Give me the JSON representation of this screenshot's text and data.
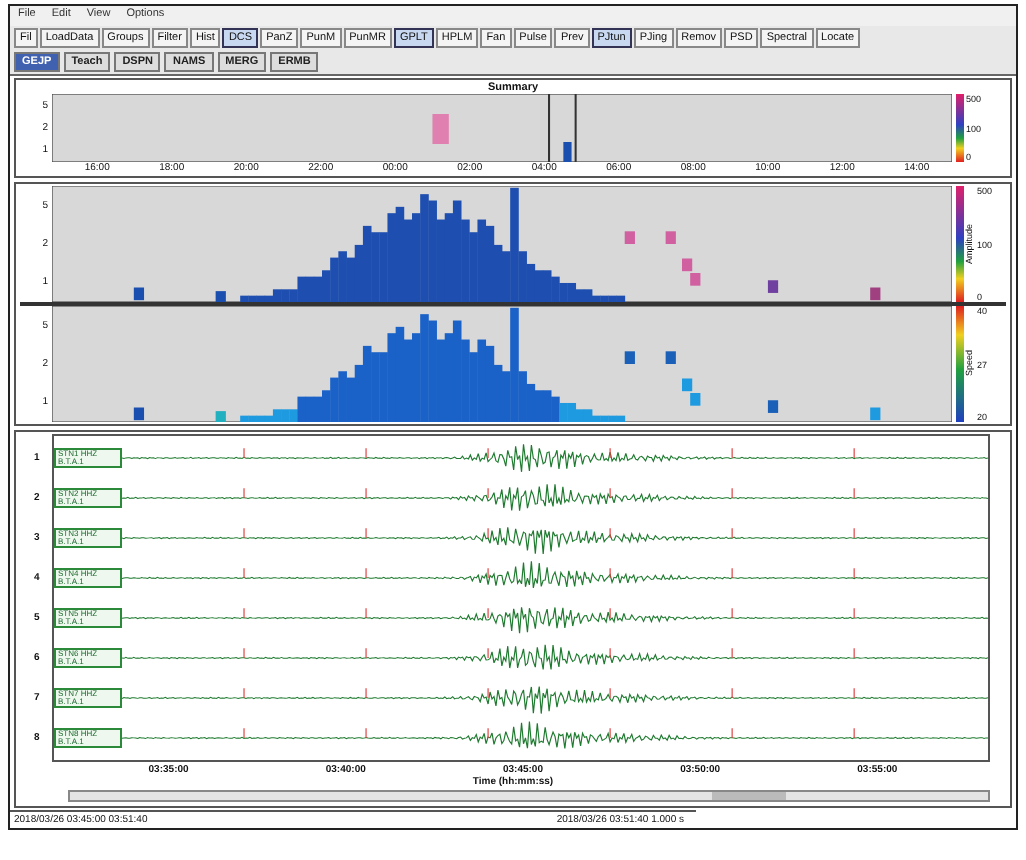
{
  "menu": [
    "File",
    "Edit",
    "View",
    "Options"
  ],
  "toolbar": [
    {
      "label": "Fil",
      "selected": false
    },
    {
      "label": "LoadData",
      "selected": false
    },
    {
      "label": "Groups",
      "selected": false
    },
    {
      "label": "Filter",
      "selected": false
    },
    {
      "label": "Hist",
      "selected": false
    },
    {
      "label": "DCS",
      "selected": true
    },
    {
      "label": "PanZ",
      "selected": false
    },
    {
      "label": "PunM",
      "selected": false
    },
    {
      "label": "PunMR",
      "selected": false
    },
    {
      "label": "GPLT",
      "selected": true
    },
    {
      "label": "HPLM",
      "selected": false
    },
    {
      "label": "Fan",
      "selected": false
    },
    {
      "label": "Pulse",
      "selected": false
    },
    {
      "label": "Prev",
      "selected": false
    },
    {
      "label": "PJtun",
      "selected": true
    },
    {
      "label": "PJing",
      "selected": false
    },
    {
      "label": "Remov",
      "selected": false
    },
    {
      "label": "PSD",
      "selected": false
    },
    {
      "label": "Spectral",
      "selected": false
    },
    {
      "label": "Locate",
      "selected": false
    }
  ],
  "tabs": [
    {
      "label": "GEJP",
      "selected": true
    },
    {
      "label": "Teach",
      "selected": false
    },
    {
      "label": "DSPN",
      "selected": false
    },
    {
      "label": "NAMS",
      "selected": false
    },
    {
      "label": "MERG",
      "selected": false
    },
    {
      "label": "ERMB",
      "selected": false
    }
  ],
  "summary": {
    "title": "Summary",
    "yticks": [
      "5",
      "2",
      "1"
    ],
    "xticks": [
      "16:00",
      "18:00",
      "20:00",
      "22:00",
      "00:00",
      "02:00",
      "04:00",
      "06:00",
      "08:00",
      "10:00",
      "12:00",
      "14:00"
    ],
    "colorbar": [
      "500",
      "100",
      "0"
    ]
  },
  "heatmaps": [
    {
      "yticks": [
        "5",
        "2",
        "1"
      ],
      "colorbar_title": "Amplitude",
      "colorbar": [
        "500",
        "100",
        "0"
      ]
    },
    {
      "yticks": [
        "5",
        "2",
        "1"
      ],
      "colorbar_title": "Speed",
      "colorbar": [
        "40",
        "27",
        "20"
      ]
    }
  ],
  "waveforms": {
    "traces": [
      {
        "number": "1",
        "label": "STN1 HHZ",
        "sub": "B.T.A.1"
      },
      {
        "number": "2",
        "label": "STN2 HHZ",
        "sub": "B.T.A.1"
      },
      {
        "number": "3",
        "label": "STN3 HHZ",
        "sub": "B.T.A.1"
      },
      {
        "number": "4",
        "label": "STN4 HHZ",
        "sub": "B.T.A.1"
      },
      {
        "number": "5",
        "label": "STN5 HHZ",
        "sub": "B.T.A.1"
      },
      {
        "number": "6",
        "label": "STN6 HHZ",
        "sub": "B.T.A.1"
      },
      {
        "number": "7",
        "label": "STN7 HHZ",
        "sub": "B.T.A.1"
      },
      {
        "number": "8",
        "label": "STN8 HHZ",
        "sub": "B.T.A.1"
      }
    ],
    "xticks": [
      "03:35:00",
      "03:40:00",
      "03:45:00",
      "03:50:00",
      "03:55:00"
    ],
    "xlabel": "Time (hh:mm:ss)"
  },
  "status_bar": {
    "left": "2018/03/26 03:45:00  03:51:40",
    "right": "2018/03/26 03:51:40  1.000 s"
  }
}
